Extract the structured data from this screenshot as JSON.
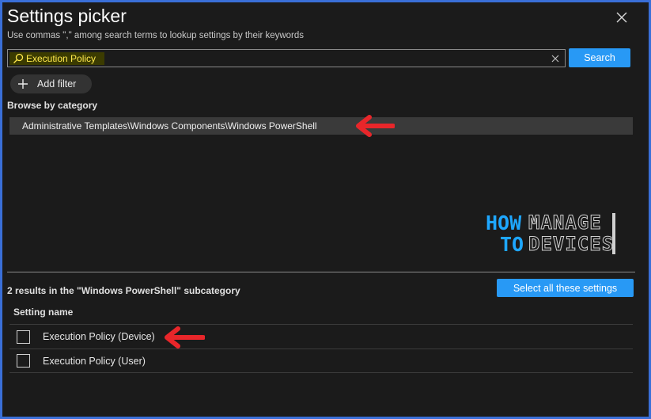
{
  "dialog": {
    "title": "Settings picker",
    "subtitle": "Use commas \",\" among search terms to lookup settings by their keywords"
  },
  "search": {
    "value": "Execution Policy",
    "button_label": "Search"
  },
  "add_filter_label": "Add filter",
  "browse": {
    "heading": "Browse by category",
    "selected_category": "Administrative Templates\\Windows Components\\Windows PowerShell"
  },
  "watermark": {
    "how": "HOW",
    "to": "TO",
    "manage": "MANAGE",
    "devices": "DEVICES"
  },
  "results": {
    "summary": "2 results in the \"Windows PowerShell\" subcategory",
    "select_all_label": "Select all these settings",
    "column_header": "Setting name",
    "items": [
      {
        "name": "Execution Policy (Device)",
        "checked": false
      },
      {
        "name": "Execution Policy (User)",
        "checked": false
      }
    ]
  },
  "colors": {
    "accent": "#2899f5",
    "annotation_arrow": "#e8262a",
    "background": "#1b1b1b",
    "border": "#3a6fd8"
  },
  "icons": [
    "close-icon",
    "search-icon",
    "clear-icon",
    "plus-icon",
    "annotation-arrow"
  ]
}
